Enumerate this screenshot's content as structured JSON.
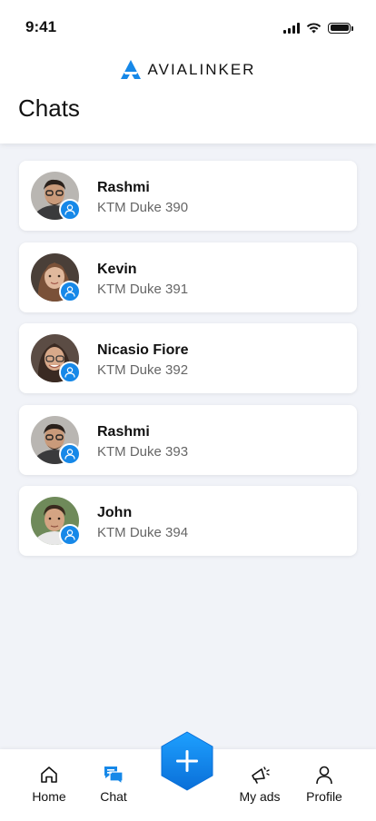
{
  "status_bar": {
    "time": "9:41"
  },
  "brand": {
    "name": "AVIALINKER"
  },
  "page": {
    "title": "Chats"
  },
  "chats": [
    {
      "name": "Rashmi",
      "subtitle": "KTM Duke 390"
    },
    {
      "name": "Kevin",
      "subtitle": "KTM Duke 391"
    },
    {
      "name": "Nicasio Fiore",
      "subtitle": "KTM Duke 392"
    },
    {
      "name": "Rashmi",
      "subtitle": "KTM Duke 393"
    },
    {
      "name": "John",
      "subtitle": "KTM Duke 394"
    }
  ],
  "nav": {
    "home": "Home",
    "chat": "Chat",
    "my_ads": "My ads",
    "profile": "Profile"
  },
  "colors": {
    "accent": "#1688e8",
    "fab": "#0a84f0"
  },
  "icons": [
    "home-icon",
    "chat-icon",
    "plus-icon",
    "megaphone-icon",
    "profile-icon",
    "user-icon"
  ]
}
